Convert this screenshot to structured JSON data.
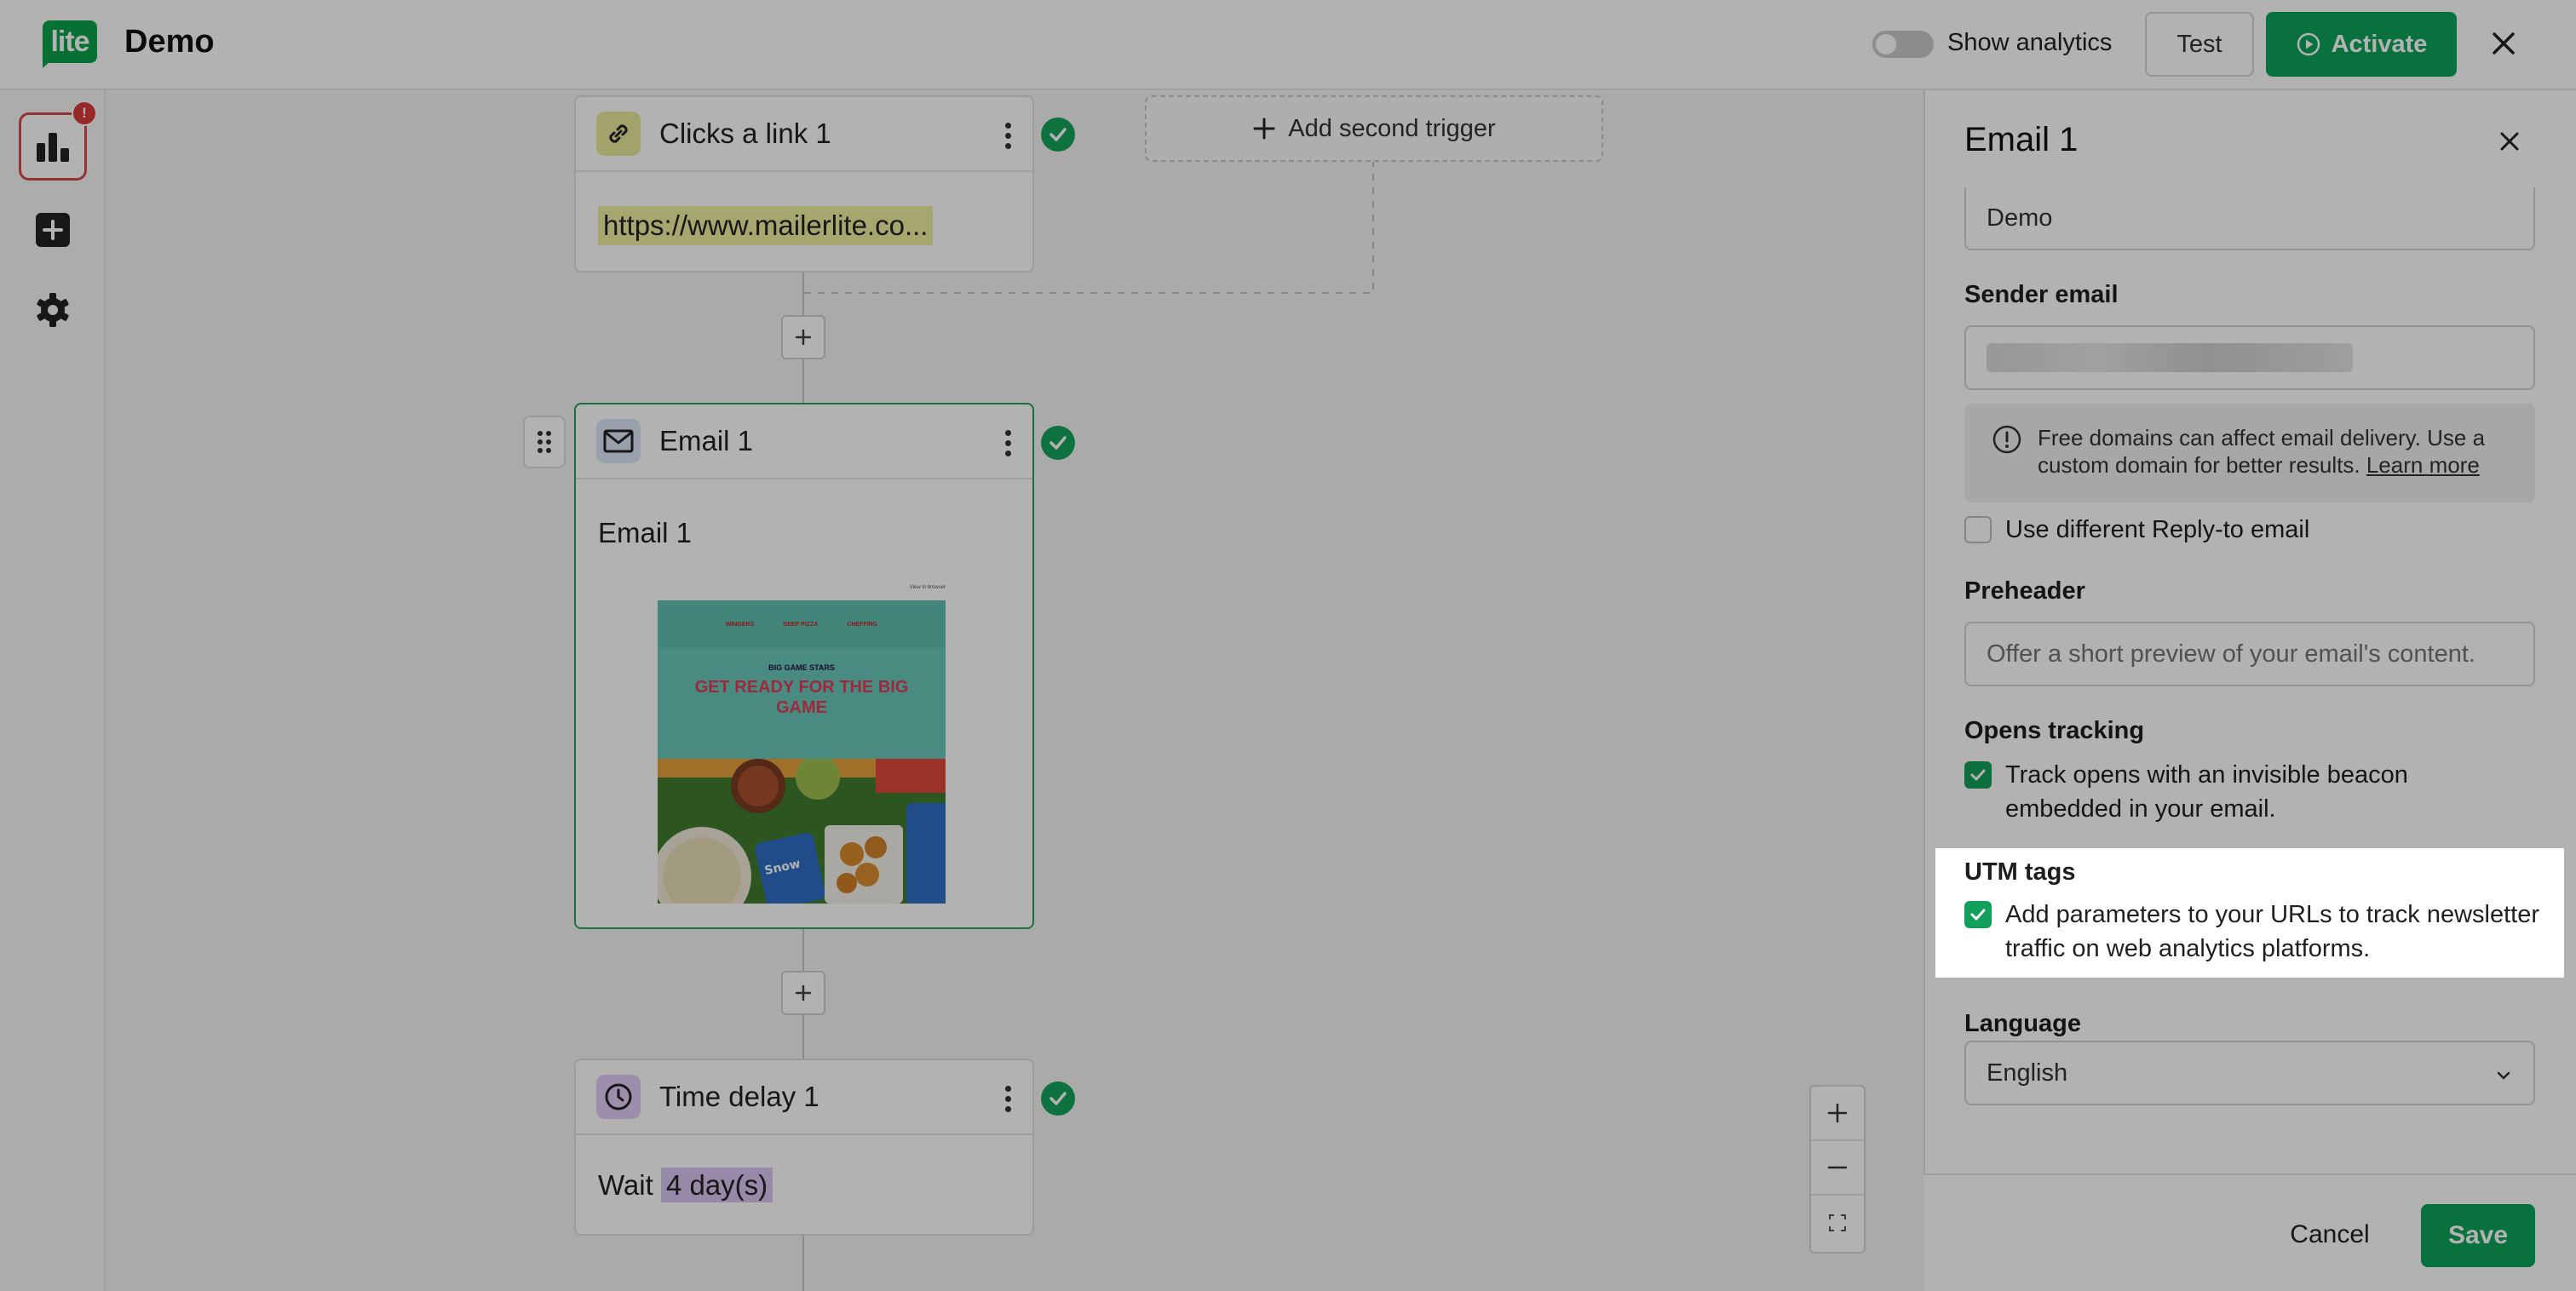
{
  "header": {
    "logo_text": "lite",
    "title": "Demo",
    "show_analytics_label": "Show analytics",
    "test_label": "Test",
    "activate_label": "Activate"
  },
  "sidebar": {
    "badge": "!"
  },
  "canvas": {
    "trigger": {
      "title": "Clicks a link 1",
      "link": "https://www.mailerlite.co..."
    },
    "add_second_trigger": "Add second trigger",
    "email_step": {
      "title": "Email 1",
      "subject": "Email 1",
      "preview": {
        "nav": [
          "WINGERS",
          "DEEP PIZZA",
          "CHEFFING"
        ],
        "top_text": "View in browser",
        "eyebrow": "BIG GAME STARS",
        "headline": "GET READY FOR THE BIG GAME"
      }
    },
    "delay_step": {
      "title": "Time delay 1",
      "wait_label": "Wait",
      "wait_value": "4 day(s)"
    }
  },
  "panel": {
    "title": "Email 1",
    "sender_name_value": "Demo",
    "sender_email_label": "Sender email",
    "info_text": "Free domains can affect email delivery. Use a custom domain for better results.",
    "info_link": "Learn more",
    "reply_to_label": "Use different Reply-to email",
    "preheader_label": "Preheader",
    "preheader_placeholder": "Offer a short preview of your email's content.",
    "opens_tracking_label": "Opens tracking",
    "opens_tracking_text": "Track opens with an invisible beacon embedded in your email.",
    "utm_label": "UTM tags",
    "utm_text": "Add parameters to your URLs to track newsletter traffic on web analytics platforms.",
    "language_label": "Language",
    "language_value": "English",
    "cancel_label": "Cancel",
    "save_label": "Save"
  },
  "colors": {
    "brand_green": "#0ea35a",
    "badge_red": "#d93b3b",
    "link_highlight": "#eef0a0",
    "delay_highlight": "#d9c6f2"
  }
}
